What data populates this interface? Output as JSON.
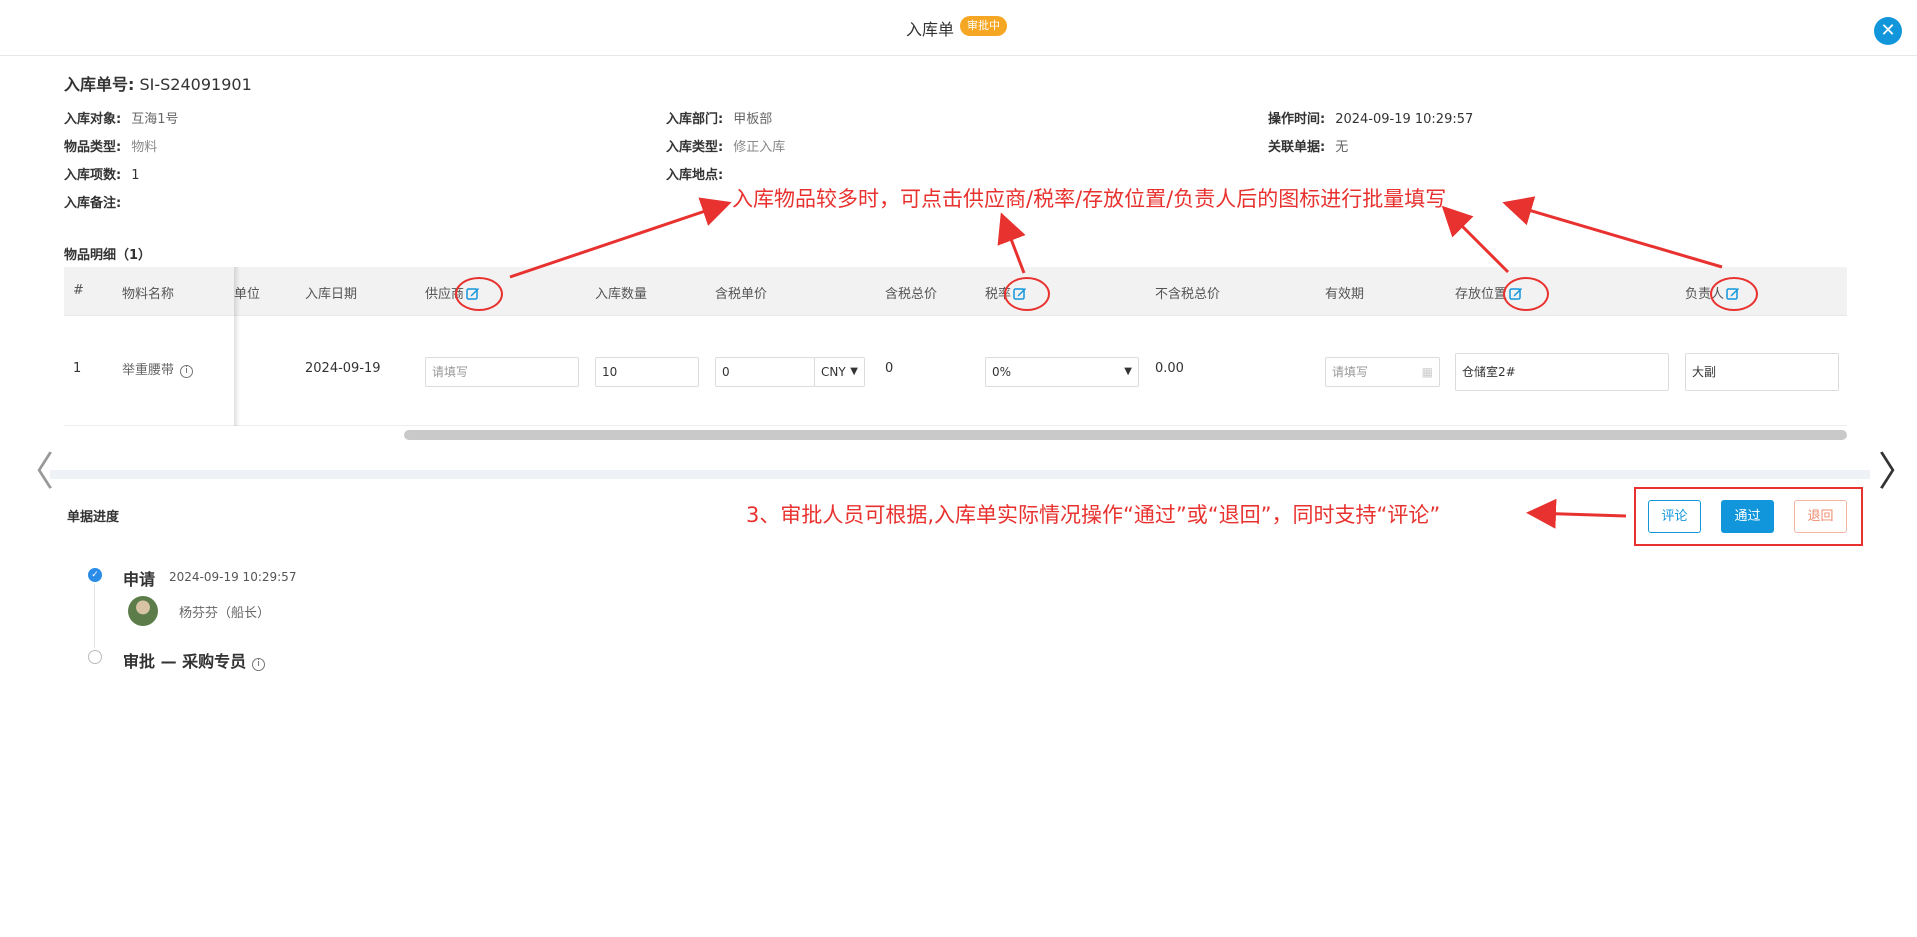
{
  "header": {
    "title": "入库单",
    "status_badge": "审批中",
    "close_symbol": "✕"
  },
  "nav": {
    "prev_symbol": "〈",
    "next_symbol": "〉"
  },
  "order": {
    "no_label": "入库单号:",
    "no_value": "SI-S24091901",
    "fields": {
      "target_label": "入库对象:",
      "target_value": "互海1号",
      "dept_label": "入库部门:",
      "dept_value": "甲板部",
      "optime_label": "操作时间:",
      "optime_value": "2024-09-19 10:29:57",
      "type_label": "物品类型:",
      "type_value": "物料",
      "intype_label": "入库类型:",
      "intype_value": "修正入库",
      "related_label": "关联单据:",
      "related_value": "无",
      "count_label": "入库项数:",
      "count_value": "1",
      "place_label": "入库地点:",
      "place_value": "",
      "remark_label": "入库备注:",
      "remark_value": ""
    }
  },
  "items": {
    "section_title": "物品明细（1）",
    "columns": {
      "index": "#",
      "name": "物料名称",
      "unit": "单位",
      "date": "入库日期",
      "supplier": "供应商",
      "qty": "入库数量",
      "unit_price": "含税单价",
      "total": "含税总价",
      "tax": "税率",
      "net_total": "不含税总价",
      "expiry": "有效期",
      "location": "存放位置",
      "owner": "负责人"
    },
    "row": {
      "index": "1",
      "name": "举重腰带",
      "unit": "",
      "date": "2024-09-19",
      "supplier_placeholder": "请填写",
      "qty": "10",
      "unit_price": "0",
      "currency": "CNY",
      "total": "0",
      "tax": "0%",
      "net_total": "0.00",
      "expiry_placeholder": "请填写",
      "location": "仓储室2#",
      "owner": "大副"
    }
  },
  "progress": {
    "title": "单据进度",
    "steps": [
      {
        "name": "申请",
        "time": "2024-09-19 10:29:57",
        "person": "杨芬芬（船长）",
        "status": "done"
      },
      {
        "name": "审批 — 采购专员",
        "status": "pending"
      }
    ]
  },
  "actions": {
    "comment": "评论",
    "pass": "通过",
    "return": "退回"
  },
  "annotations": {
    "batch_fill": "入库物品较多时，可点击供应商/税率/存放位置/负责人后的图标进行批量填写",
    "approval": "3、审批人员可根据,入库单实际情况操作“通过”或“退回”，同时支持“评论”"
  },
  "colors": {
    "primary": "#1296db",
    "badge": "#f5a623",
    "annotation": "#e8322f",
    "return": "#f08a6d"
  }
}
